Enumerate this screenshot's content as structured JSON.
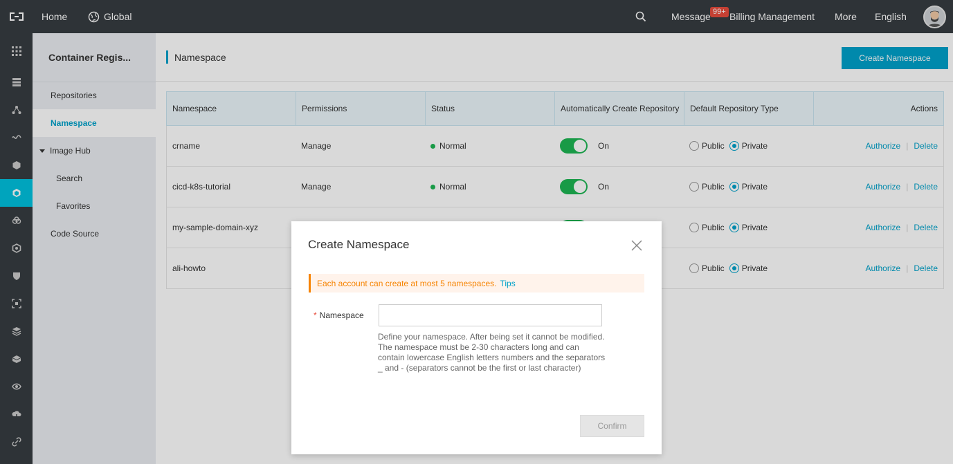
{
  "topbar": {
    "home": "Home",
    "region": "Global",
    "message": "Message",
    "message_badge": "99+",
    "billing": "Billing Management",
    "more": "More",
    "language": "English"
  },
  "sidebar": {
    "title": "Container Regis...",
    "items": [
      {
        "label": "Repositories"
      },
      {
        "label": "Namespace"
      },
      {
        "label": "Image Hub"
      },
      {
        "label": "Search"
      },
      {
        "label": "Favorites"
      },
      {
        "label": "Code Source"
      }
    ]
  },
  "page": {
    "title": "Namespace",
    "create_button": "Create Namespace"
  },
  "table": {
    "headers": [
      "Namespace",
      "Permissions",
      "Status",
      "Automatically Create Repository",
      "Default Repository Type",
      "Actions"
    ],
    "rows": [
      {
        "namespace": "crname",
        "permissions": "Manage",
        "status": "Normal",
        "auto": "On",
        "public": "Public",
        "private": "Private",
        "authorize": "Authorize",
        "delete": "Delete"
      },
      {
        "namespace": "cicd-k8s-tutorial",
        "permissions": "Manage",
        "status": "Normal",
        "auto": "On",
        "public": "Public",
        "private": "Private",
        "authorize": "Authorize",
        "delete": "Delete"
      },
      {
        "namespace": "my-sample-domain-xyz",
        "permissions": "",
        "status": "",
        "auto": "",
        "public": "Public",
        "private": "Private",
        "authorize": "Authorize",
        "delete": "Delete"
      },
      {
        "namespace": "ali-howto",
        "permissions": "",
        "status": "",
        "auto": "",
        "public": "Public",
        "private": "Private",
        "authorize": "Authorize",
        "delete": "Delete"
      }
    ],
    "separator": "|"
  },
  "modal": {
    "title": "Create Namespace",
    "alert": "Each account can create at most 5 namespaces.",
    "alert_link": "Tips",
    "field_required": "*",
    "field_label": "Namespace",
    "field_value": "",
    "help": "Define your namespace. After being set it cannot be modified. The namespace must be 2-30 characters long and can contain lowercase English letters numbers and the separators _ and - (separators cannot be the first or last character)",
    "confirm": "Confirm"
  },
  "colors": {
    "accent": "#00a2ca",
    "topbar": "#373d41",
    "active_rail": "#00c1de",
    "success": "#1db553",
    "warning": "#f68300"
  }
}
